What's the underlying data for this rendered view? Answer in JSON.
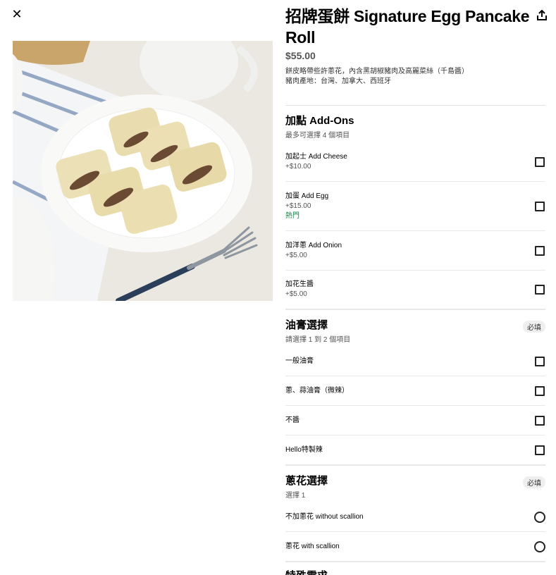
{
  "close_icon": "close-icon",
  "share_icon": "share-icon",
  "item": {
    "title": "招牌蛋餅 Signature Egg Pancake Roll",
    "price": "$55.00",
    "description_lines": [
      "餅皮略帶些許蔥花，內含黑胡椒豬肉及高麗菜絲（千島醬）",
      "豬肉產地：台灣、加拿大、西班牙"
    ]
  },
  "sections": [
    {
      "title": "加點 Add-Ons",
      "subtitle": "最多可選擇 4 個項目",
      "required_label": "",
      "options": [
        {
          "name": "加起士 Add Cheese",
          "price": "+$10.00",
          "tag": ""
        },
        {
          "name": "加蛋 Add Egg",
          "price": "+$15.00",
          "tag": "熱門"
        },
        {
          "name": "加洋蔥 Add Onion",
          "price": "+$5.00",
          "tag": ""
        },
        {
          "name": "加花生醬",
          "price": "+$5.00",
          "tag": ""
        }
      ]
    },
    {
      "title": "油膏選擇",
      "subtitle": "請選擇 1 到 2 個項目",
      "required_label": "必填",
      "options": [
        {
          "name": "一般油膏"
        },
        {
          "name": "蔥、蒜油膏（微辣）"
        },
        {
          "name": "不醬"
        },
        {
          "name": "Hello特製辣"
        }
      ]
    },
    {
      "title": "蔥花選擇",
      "subtitle": "選擇 1",
      "required_label": "必填",
      "options": [
        {
          "name": "不加蔥花 without scallion"
        },
        {
          "name": "蔥花 with scallion"
        }
      ]
    }
  ],
  "next_section_partial": "特殊需求"
}
